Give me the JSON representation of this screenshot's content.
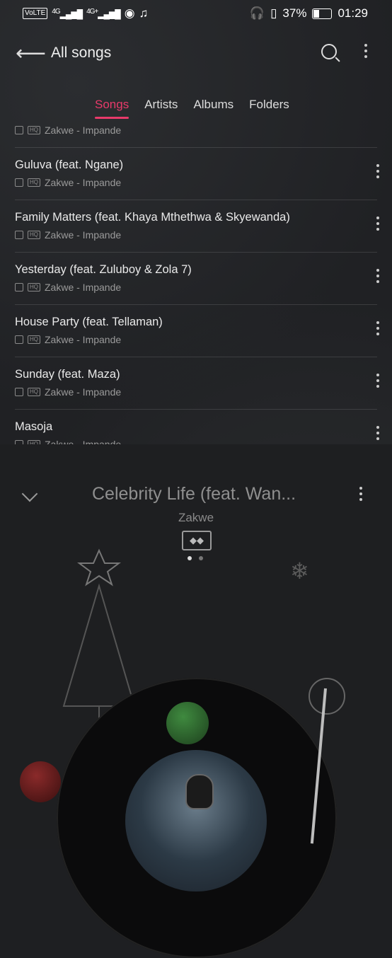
{
  "status": {
    "left_icons": [
      "volte-icon",
      "signal-4g-icon",
      "signal-4g-plus-icon",
      "hotspot-icon",
      "music-note-icon"
    ],
    "network_a": "4G",
    "network_b": "4G+",
    "volte": "VoLTE",
    "battery_percent": "37%",
    "battery_level": 0.37,
    "time": "01:29"
  },
  "appbar": {
    "title": "All songs"
  },
  "tabs": [
    {
      "label": "Songs",
      "active": true
    },
    {
      "label": "Artists",
      "active": false
    },
    {
      "label": "Albums",
      "active": false
    },
    {
      "label": "Folders",
      "active": false
    }
  ],
  "songs": [
    {
      "title": "",
      "meta": "Zakwe - Impande"
    },
    {
      "title": "Guluva (feat. Ngane)",
      "meta": "Zakwe - Impande"
    },
    {
      "title": "Family Matters (feat. Khaya Mthethwa & Skyewanda)",
      "meta": "Zakwe - Impande"
    },
    {
      "title": "Yesterday (feat. Zuluboy & Zola 7)",
      "meta": "Zakwe - Impande"
    },
    {
      "title": "House Party (feat. Tellaman)",
      "meta": "Zakwe - Impande"
    },
    {
      "title": "Sunday (feat. Maza)",
      "meta": "Zakwe - Impande"
    },
    {
      "title": "Masoja",
      "meta": "Zakwe - Impande"
    }
  ],
  "hq_badge": "HQ",
  "player": {
    "title": "Celebrity Life (feat. Wan...",
    "artist": "Zakwe",
    "page_index": 0,
    "page_count": 2
  }
}
